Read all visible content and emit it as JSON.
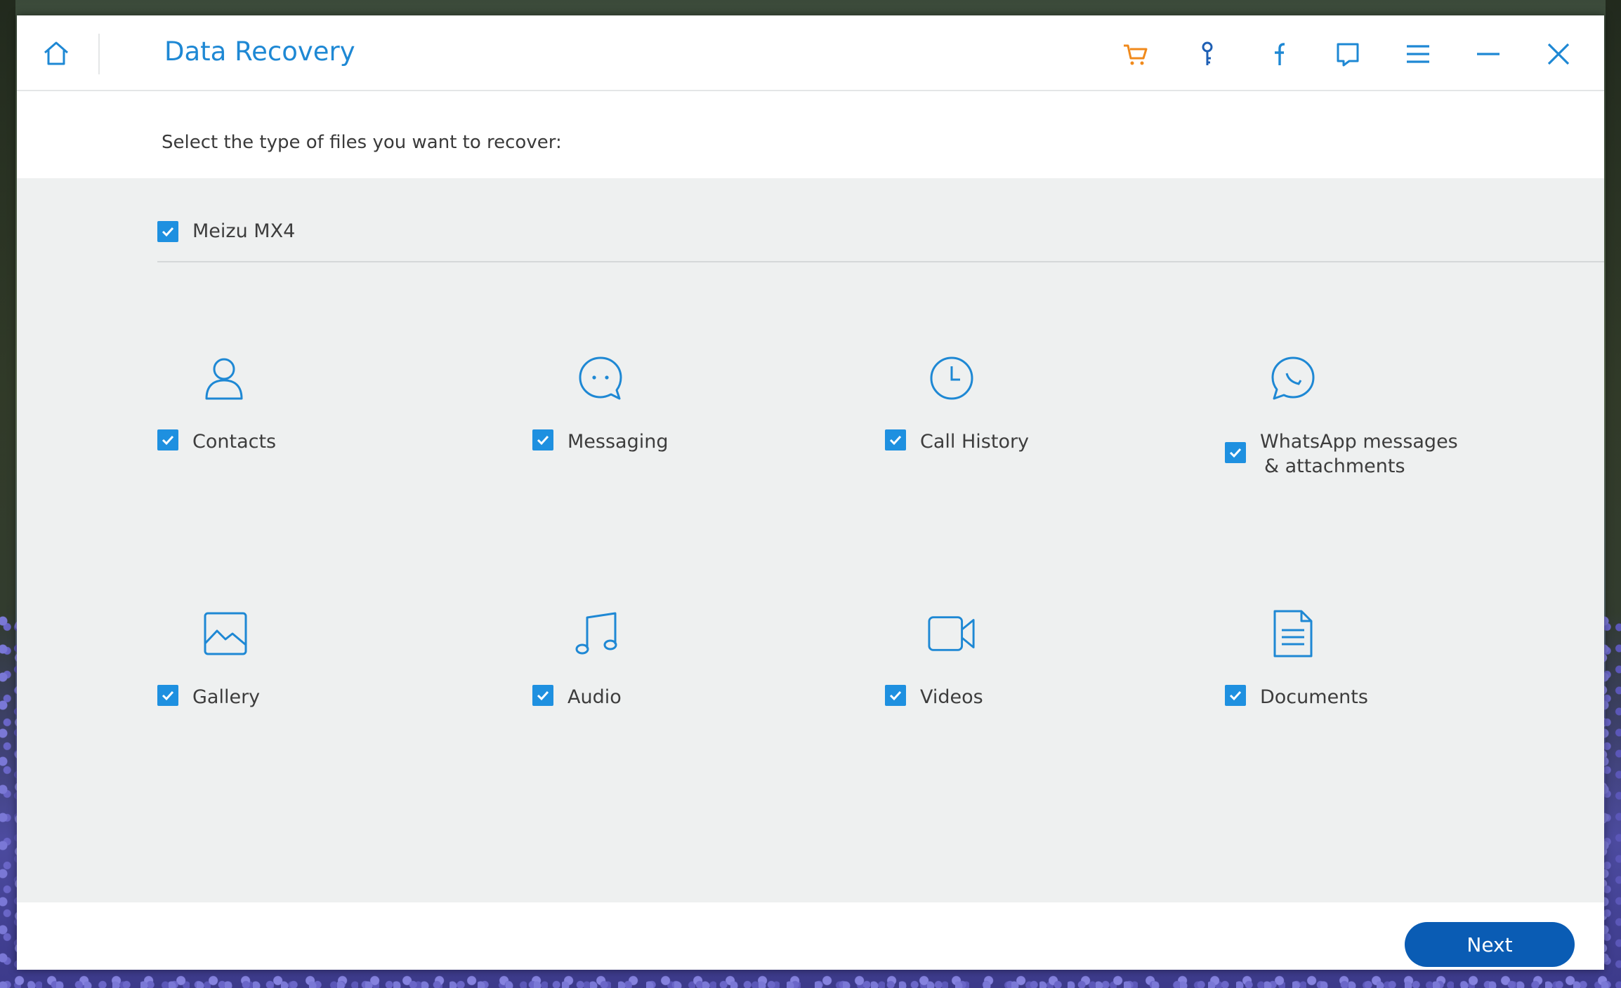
{
  "window": {
    "title": "Data Recovery"
  },
  "toolbar": {
    "icons": [
      "home-icon",
      "cart-icon",
      "key-icon",
      "facebook-icon",
      "feedback-icon",
      "menu-icon",
      "minimize-icon",
      "close-icon"
    ]
  },
  "prompt": "Select the type of files you want to recover:",
  "device": {
    "name": "Meizu MX4",
    "checked": true
  },
  "file_types": [
    {
      "label": "Contacts",
      "icon": "contact-icon",
      "checked": true
    },
    {
      "label": "Messaging",
      "icon": "message-icon",
      "checked": true
    },
    {
      "label": "Call History",
      "icon": "clock-icon",
      "checked": true
    },
    {
      "label_line1": "WhatsApp messages",
      "label_line2": "& attachments",
      "icon": "whatsapp-icon",
      "checked": true
    },
    {
      "label": "Gallery",
      "icon": "image-icon",
      "checked": true
    },
    {
      "label": "Audio",
      "icon": "music-icon",
      "checked": true
    },
    {
      "label": "Videos",
      "icon": "video-icon",
      "checked": true
    },
    {
      "label": "Documents",
      "icon": "document-icon",
      "checked": true
    }
  ],
  "footer": {
    "next_label": "Next"
  },
  "colors": {
    "accent": "#1e88d4",
    "checkbox": "#1e90e0",
    "button": "#0a5cb4",
    "cart": "#f08a1c",
    "content_bg": "#eef0f0"
  }
}
